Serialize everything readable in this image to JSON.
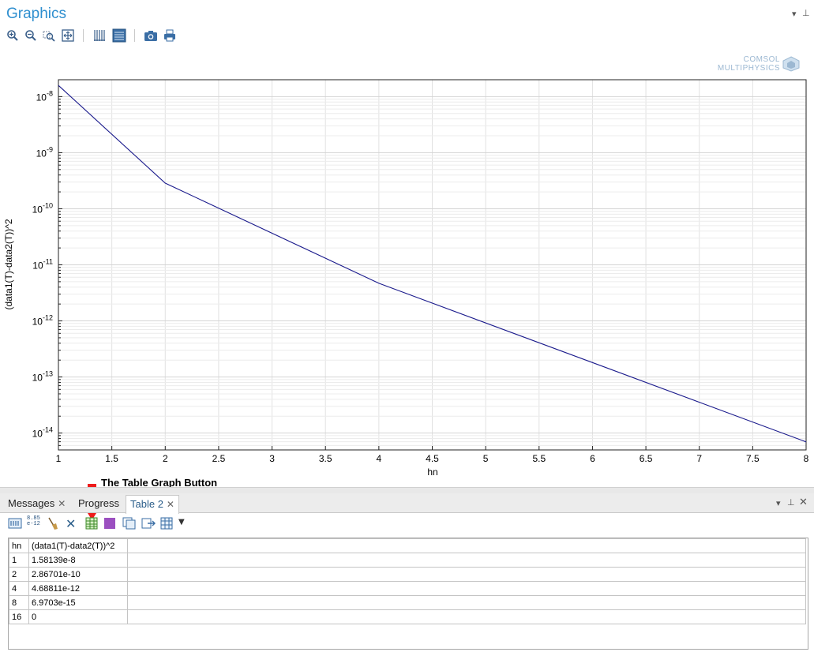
{
  "graphics": {
    "title": "Graphics",
    "watermark": [
      "COMSOL",
      "MULTIPHYSICS"
    ],
    "toolbar_icons": [
      "zoom-in-icon",
      "zoom-out-icon",
      "zoom-box-icon",
      "zoom-extents-icon",
      "grid-toggle-icon",
      "table-view-icon",
      "camera-icon",
      "print-icon"
    ]
  },
  "chart_data": {
    "type": "line",
    "x": [
      1,
      2,
      4,
      8
    ],
    "y": [
      1.58139e-08,
      2.86701e-10,
      4.68811e-12,
      6.9703e-15
    ],
    "xlabel": "hn",
    "ylabel": "(data1(T)-data2(T))^2",
    "xlim": [
      1,
      8
    ],
    "ylim": [
      5e-15,
      2e-08
    ],
    "yscale": "log",
    "x_ticks": [
      "1",
      "1.5",
      "2",
      "2.5",
      "3",
      "3.5",
      "4",
      "4.5",
      "5",
      "5.5",
      "6",
      "6.5",
      "7",
      "7.5",
      "8"
    ],
    "y_tick_exponents": [
      "-8",
      "-9",
      "-10",
      "-11",
      "-12",
      "-13",
      "-14"
    ],
    "grid": true,
    "line_color": "#1a1a8c"
  },
  "annotation": {
    "label": "The Table Graph Button",
    "arrow_color": "#ee1c1c"
  },
  "bottom_panel": {
    "tabs": [
      {
        "label": "Messages",
        "active": false
      },
      {
        "label": "Progress",
        "active": false
      },
      {
        "label": "Table 2",
        "active": true
      }
    ],
    "toolbar_icons": [
      "full-precision-icon",
      "auto-precision-icon",
      "clear-table-icon",
      "delete-icon",
      "table-graph-icon",
      "table-surface-icon",
      "copy-table-icon",
      "export-icon",
      "table-settings-icon",
      "dropdown-icon"
    ],
    "full_precision_text": "8.85",
    "full_precision_sub": "e-12",
    "table": {
      "headers": [
        "hn",
        "(data1(T)-data2(T))^2"
      ],
      "rows": [
        [
          "1",
          "1.58139e-8"
        ],
        [
          "2",
          "2.86701e-10"
        ],
        [
          "4",
          "4.68811e-12"
        ],
        [
          "8",
          "6.9703e-15"
        ],
        [
          "16",
          "0"
        ]
      ]
    }
  }
}
